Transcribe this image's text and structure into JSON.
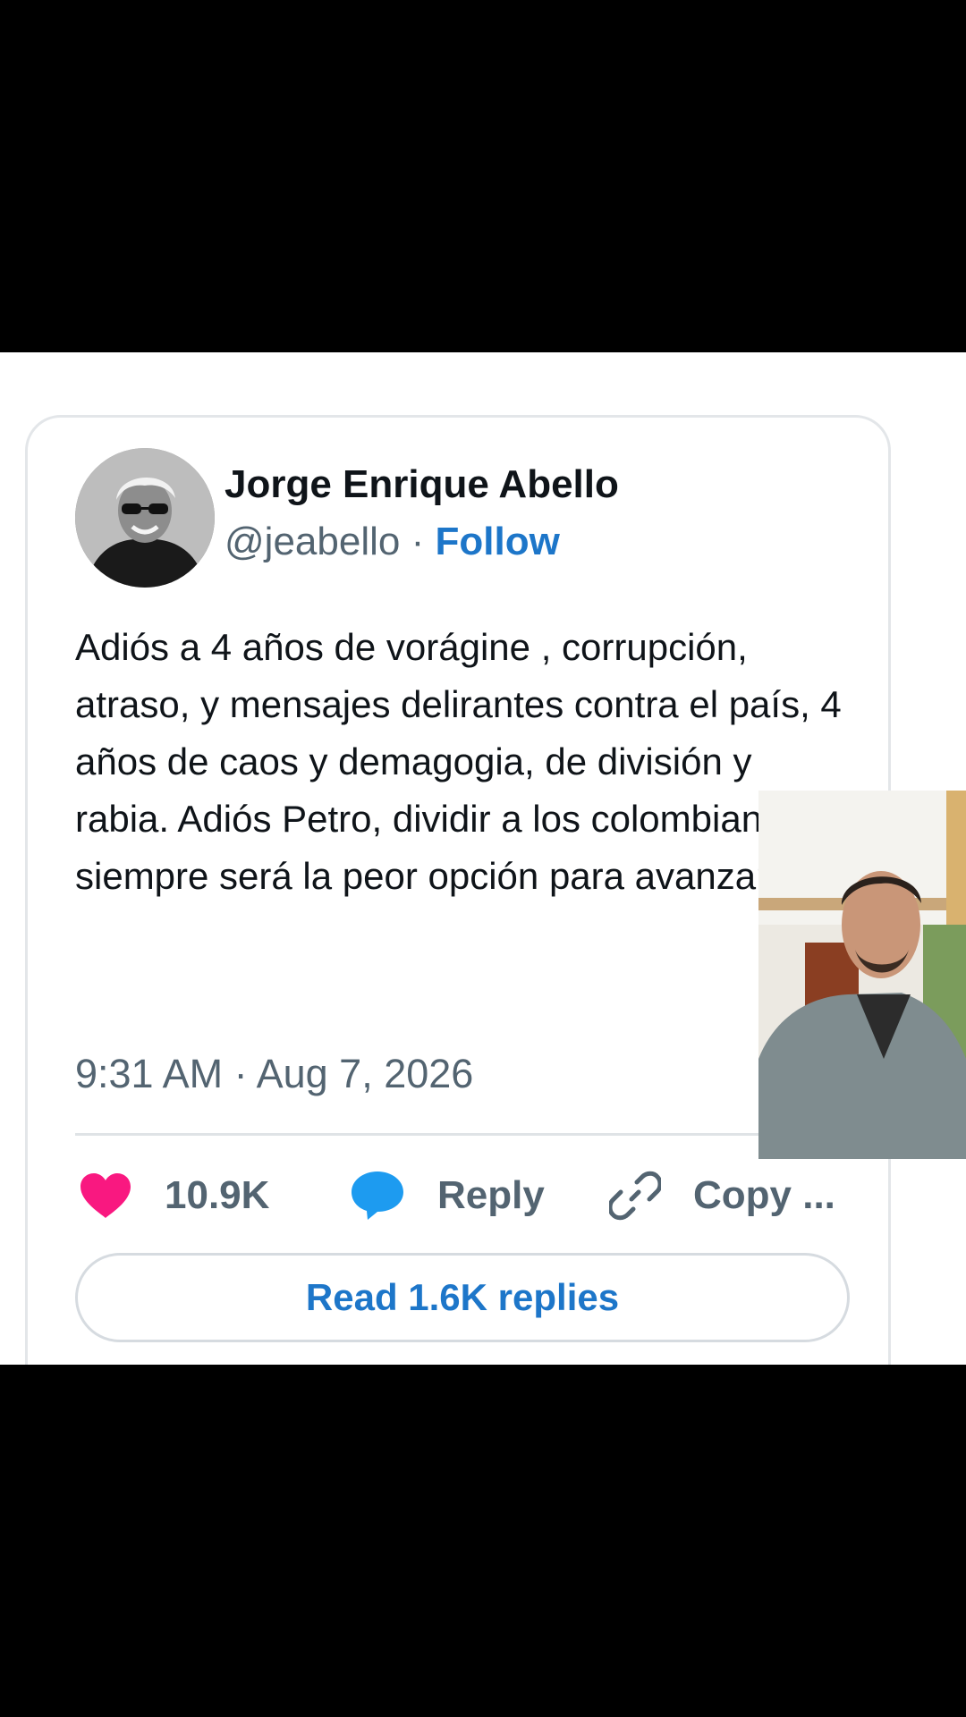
{
  "post": {
    "author_name": "Jorge Enrique Abello",
    "handle": "@jeabello",
    "separator": "·",
    "follow_label": "Follow",
    "text": "Adiós a 4 años de vorágine , corrupción, atraso, y mensajes delirantes contra el país, 4 años de caos y demagogia, de división y rabia. Adiós Petro, dividir a los colombianos siempre será la peor opción para avanzar.",
    "timestamp": "9:31 AM · Aug 7, 2026",
    "info_icon": "info-icon"
  },
  "actions": {
    "like": {
      "icon": "heart-icon",
      "count": "10.9K",
      "color": "#f91880"
    },
    "reply": {
      "icon": "speech-bubble-icon",
      "label": "Reply",
      "color": "#1d9bf0"
    },
    "copy": {
      "icon": "link-icon",
      "label": "Copy ..."
    }
  },
  "replies_button": {
    "label": "Read 1.6K replies"
  },
  "colors": {
    "accent": "#1d76c9",
    "text_primary": "#0f1419",
    "text_secondary": "#536471",
    "border": "#e3e6e9",
    "background": "#ffffff",
    "letterbox": "#000000"
  },
  "overlay": {
    "type": "picture-in-picture video of a person"
  }
}
